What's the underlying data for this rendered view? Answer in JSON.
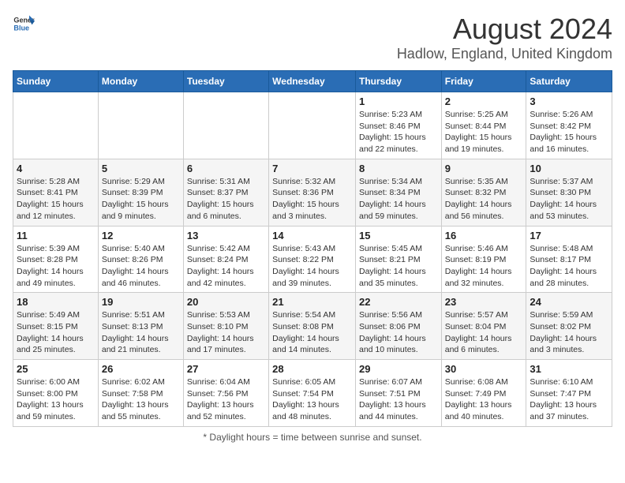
{
  "header": {
    "logo_general": "General",
    "logo_blue": "Blue",
    "month_year": "August 2024",
    "location": "Hadlow, England, United Kingdom"
  },
  "days_of_week": [
    "Sunday",
    "Monday",
    "Tuesday",
    "Wednesday",
    "Thursday",
    "Friday",
    "Saturday"
  ],
  "footer": {
    "note": "Daylight hours"
  },
  "weeks": [
    [
      {
        "day": "",
        "sunrise": "",
        "sunset": "",
        "daylight": ""
      },
      {
        "day": "",
        "sunrise": "",
        "sunset": "",
        "daylight": ""
      },
      {
        "day": "",
        "sunrise": "",
        "sunset": "",
        "daylight": ""
      },
      {
        "day": "",
        "sunrise": "",
        "sunset": "",
        "daylight": ""
      },
      {
        "day": "1",
        "sunrise": "Sunrise: 5:23 AM",
        "sunset": "Sunset: 8:46 PM",
        "daylight": "Daylight: 15 hours and 22 minutes."
      },
      {
        "day": "2",
        "sunrise": "Sunrise: 5:25 AM",
        "sunset": "Sunset: 8:44 PM",
        "daylight": "Daylight: 15 hours and 19 minutes."
      },
      {
        "day": "3",
        "sunrise": "Sunrise: 5:26 AM",
        "sunset": "Sunset: 8:42 PM",
        "daylight": "Daylight: 15 hours and 16 minutes."
      }
    ],
    [
      {
        "day": "4",
        "sunrise": "Sunrise: 5:28 AM",
        "sunset": "Sunset: 8:41 PM",
        "daylight": "Daylight: 15 hours and 12 minutes."
      },
      {
        "day": "5",
        "sunrise": "Sunrise: 5:29 AM",
        "sunset": "Sunset: 8:39 PM",
        "daylight": "Daylight: 15 hours and 9 minutes."
      },
      {
        "day": "6",
        "sunrise": "Sunrise: 5:31 AM",
        "sunset": "Sunset: 8:37 PM",
        "daylight": "Daylight: 15 hours and 6 minutes."
      },
      {
        "day": "7",
        "sunrise": "Sunrise: 5:32 AM",
        "sunset": "Sunset: 8:36 PM",
        "daylight": "Daylight: 15 hours and 3 minutes."
      },
      {
        "day": "8",
        "sunrise": "Sunrise: 5:34 AM",
        "sunset": "Sunset: 8:34 PM",
        "daylight": "Daylight: 14 hours and 59 minutes."
      },
      {
        "day": "9",
        "sunrise": "Sunrise: 5:35 AM",
        "sunset": "Sunset: 8:32 PM",
        "daylight": "Daylight: 14 hours and 56 minutes."
      },
      {
        "day": "10",
        "sunrise": "Sunrise: 5:37 AM",
        "sunset": "Sunset: 8:30 PM",
        "daylight": "Daylight: 14 hours and 53 minutes."
      }
    ],
    [
      {
        "day": "11",
        "sunrise": "Sunrise: 5:39 AM",
        "sunset": "Sunset: 8:28 PM",
        "daylight": "Daylight: 14 hours and 49 minutes."
      },
      {
        "day": "12",
        "sunrise": "Sunrise: 5:40 AM",
        "sunset": "Sunset: 8:26 PM",
        "daylight": "Daylight: 14 hours and 46 minutes."
      },
      {
        "day": "13",
        "sunrise": "Sunrise: 5:42 AM",
        "sunset": "Sunset: 8:24 PM",
        "daylight": "Daylight: 14 hours and 42 minutes."
      },
      {
        "day": "14",
        "sunrise": "Sunrise: 5:43 AM",
        "sunset": "Sunset: 8:22 PM",
        "daylight": "Daylight: 14 hours and 39 minutes."
      },
      {
        "day": "15",
        "sunrise": "Sunrise: 5:45 AM",
        "sunset": "Sunset: 8:21 PM",
        "daylight": "Daylight: 14 hours and 35 minutes."
      },
      {
        "day": "16",
        "sunrise": "Sunrise: 5:46 AM",
        "sunset": "Sunset: 8:19 PM",
        "daylight": "Daylight: 14 hours and 32 minutes."
      },
      {
        "day": "17",
        "sunrise": "Sunrise: 5:48 AM",
        "sunset": "Sunset: 8:17 PM",
        "daylight": "Daylight: 14 hours and 28 minutes."
      }
    ],
    [
      {
        "day": "18",
        "sunrise": "Sunrise: 5:49 AM",
        "sunset": "Sunset: 8:15 PM",
        "daylight": "Daylight: 14 hours and 25 minutes."
      },
      {
        "day": "19",
        "sunrise": "Sunrise: 5:51 AM",
        "sunset": "Sunset: 8:13 PM",
        "daylight": "Daylight: 14 hours and 21 minutes."
      },
      {
        "day": "20",
        "sunrise": "Sunrise: 5:53 AM",
        "sunset": "Sunset: 8:10 PM",
        "daylight": "Daylight: 14 hours and 17 minutes."
      },
      {
        "day": "21",
        "sunrise": "Sunrise: 5:54 AM",
        "sunset": "Sunset: 8:08 PM",
        "daylight": "Daylight: 14 hours and 14 minutes."
      },
      {
        "day": "22",
        "sunrise": "Sunrise: 5:56 AM",
        "sunset": "Sunset: 8:06 PM",
        "daylight": "Daylight: 14 hours and 10 minutes."
      },
      {
        "day": "23",
        "sunrise": "Sunrise: 5:57 AM",
        "sunset": "Sunset: 8:04 PM",
        "daylight": "Daylight: 14 hours and 6 minutes."
      },
      {
        "day": "24",
        "sunrise": "Sunrise: 5:59 AM",
        "sunset": "Sunset: 8:02 PM",
        "daylight": "Daylight: 14 hours and 3 minutes."
      }
    ],
    [
      {
        "day": "25",
        "sunrise": "Sunrise: 6:00 AM",
        "sunset": "Sunset: 8:00 PM",
        "daylight": "Daylight: 13 hours and 59 minutes."
      },
      {
        "day": "26",
        "sunrise": "Sunrise: 6:02 AM",
        "sunset": "Sunset: 7:58 PM",
        "daylight": "Daylight: 13 hours and 55 minutes."
      },
      {
        "day": "27",
        "sunrise": "Sunrise: 6:04 AM",
        "sunset": "Sunset: 7:56 PM",
        "daylight": "Daylight: 13 hours and 52 minutes."
      },
      {
        "day": "28",
        "sunrise": "Sunrise: 6:05 AM",
        "sunset": "Sunset: 7:54 PM",
        "daylight": "Daylight: 13 hours and 48 minutes."
      },
      {
        "day": "29",
        "sunrise": "Sunrise: 6:07 AM",
        "sunset": "Sunset: 7:51 PM",
        "daylight": "Daylight: 13 hours and 44 minutes."
      },
      {
        "day": "30",
        "sunrise": "Sunrise: 6:08 AM",
        "sunset": "Sunset: 7:49 PM",
        "daylight": "Daylight: 13 hours and 40 minutes."
      },
      {
        "day": "31",
        "sunrise": "Sunrise: 6:10 AM",
        "sunset": "Sunset: 7:47 PM",
        "daylight": "Daylight: 13 hours and 37 minutes."
      }
    ]
  ]
}
